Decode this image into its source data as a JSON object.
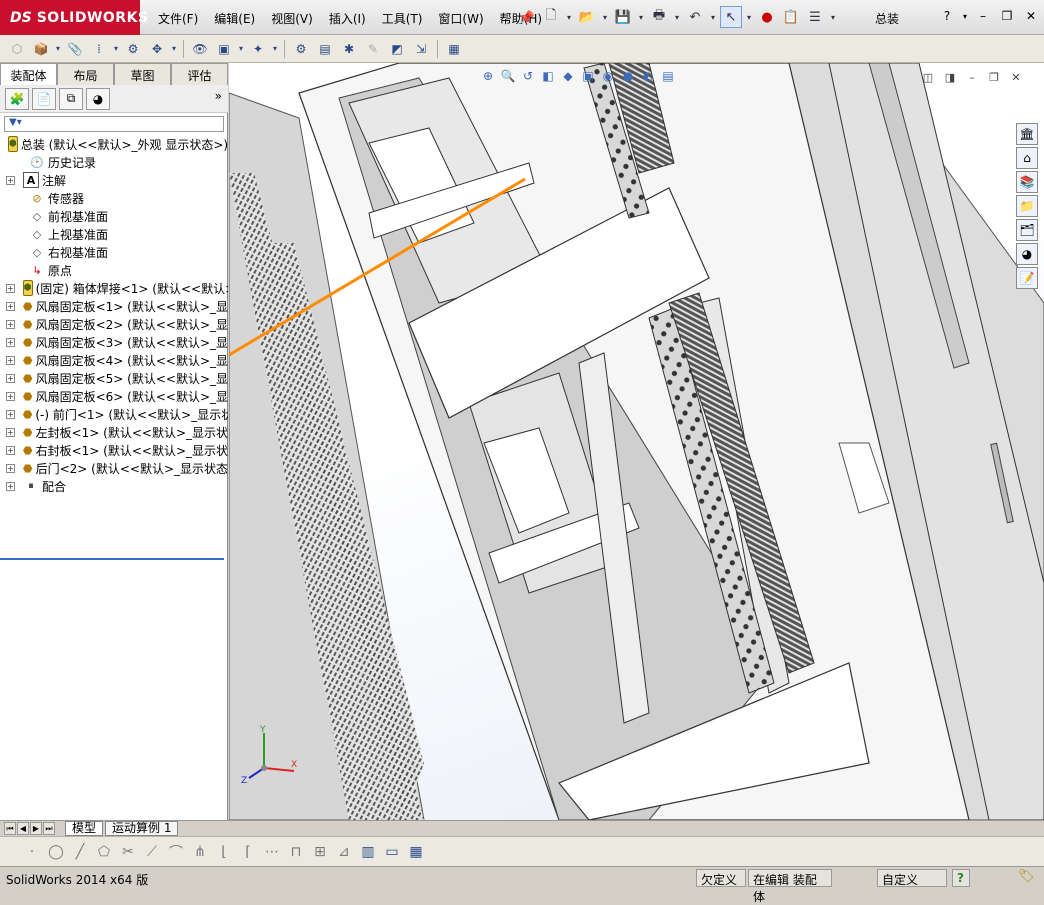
{
  "app": {
    "logo_ds": "DS",
    "logo_name": "SOLIDWORKS",
    "document_title": "总装",
    "status_app": "SolidWorks 2014 x64 版"
  },
  "menu": [
    {
      "label": "文件(F)"
    },
    {
      "label": "编辑(E)"
    },
    {
      "label": "视图(V)"
    },
    {
      "label": "插入(I)"
    },
    {
      "label": "工具(T)"
    },
    {
      "label": "窗口(W)"
    },
    {
      "label": "帮助(H)"
    }
  ],
  "tabs": [
    {
      "label": "装配体",
      "active": true
    },
    {
      "label": "布局",
      "active": false
    },
    {
      "label": "草图",
      "active": false
    },
    {
      "label": "评估",
      "active": false
    }
  ],
  "tree": [
    {
      "label": "总装 (默认<<默认>_外观 显示状态>)",
      "icon": "assembly-icon",
      "expand": "none",
      "indent": 0
    },
    {
      "label": "历史记录",
      "icon": "history-icon",
      "expand": "none",
      "indent": 1
    },
    {
      "label": "注解",
      "icon": "annotation-icon",
      "expand": "+",
      "indent": 1
    },
    {
      "label": "传感器",
      "icon": "sensor-icon",
      "expand": "none",
      "indent": 1
    },
    {
      "label": "前视基准面",
      "icon": "plane-icon",
      "expand": "none",
      "indent": 1
    },
    {
      "label": "上视基准面",
      "icon": "plane-icon",
      "expand": "none",
      "indent": 1
    },
    {
      "label": "右视基准面",
      "icon": "plane-icon",
      "expand": "none",
      "indent": 1
    },
    {
      "label": "原点",
      "icon": "origin-icon",
      "expand": "none",
      "indent": 1
    },
    {
      "label": "(固定) 箱体焊接<1> (默认<<默认>",
      "icon": "subassembly-icon",
      "expand": "+",
      "indent": 1
    },
    {
      "label": "风扇固定板<1> (默认<<默认>_显",
      "icon": "part-icon",
      "expand": "+",
      "indent": 1
    },
    {
      "label": "风扇固定板<2> (默认<<默认>_显",
      "icon": "part-icon",
      "expand": "+",
      "indent": 1
    },
    {
      "label": "风扇固定板<3> (默认<<默认>_显",
      "icon": "part-icon",
      "expand": "+",
      "indent": 1
    },
    {
      "label": "风扇固定板<4> (默认<<默认>_显",
      "icon": "part-icon",
      "expand": "+",
      "indent": 1
    },
    {
      "label": "风扇固定板<5> (默认<<默认>_显",
      "icon": "part-icon",
      "expand": "+",
      "indent": 1
    },
    {
      "label": "风扇固定板<6> (默认<<默认>_显",
      "icon": "part-icon",
      "expand": "+",
      "indent": 1
    },
    {
      "label": "(-) 前门<1> (默认<<默认>_显示状",
      "icon": "part-icon",
      "expand": "+",
      "indent": 1
    },
    {
      "label": "左封板<1> (默认<<默认>_显示状",
      "icon": "part-icon",
      "expand": "+",
      "indent": 1
    },
    {
      "label": "右封板<1> (默认<<默认>_显示状",
      "icon": "part-icon",
      "expand": "+",
      "indent": 1
    },
    {
      "label": "后门<2> (默认<<默认>_显示状态",
      "icon": "part-icon",
      "expand": "+",
      "indent": 1
    },
    {
      "label": "配合",
      "icon": "mates-icon",
      "expand": "+",
      "indent": 1
    }
  ],
  "bottom_tabs": [
    {
      "label": "模型",
      "active": true
    },
    {
      "label": "运动算例 1",
      "active": false
    }
  ],
  "status_cells": [
    {
      "label": "欠定义"
    },
    {
      "label": "在编辑 装配体"
    },
    {
      "label": "自定义"
    },
    {
      "label": "?"
    }
  ],
  "triad": {
    "x": "X",
    "y": "Y",
    "z": "Z"
  },
  "colors": {
    "brand": "#c8102e",
    "selection_line": "#ff8c00",
    "tree_active_line": "#3a6bc4"
  }
}
